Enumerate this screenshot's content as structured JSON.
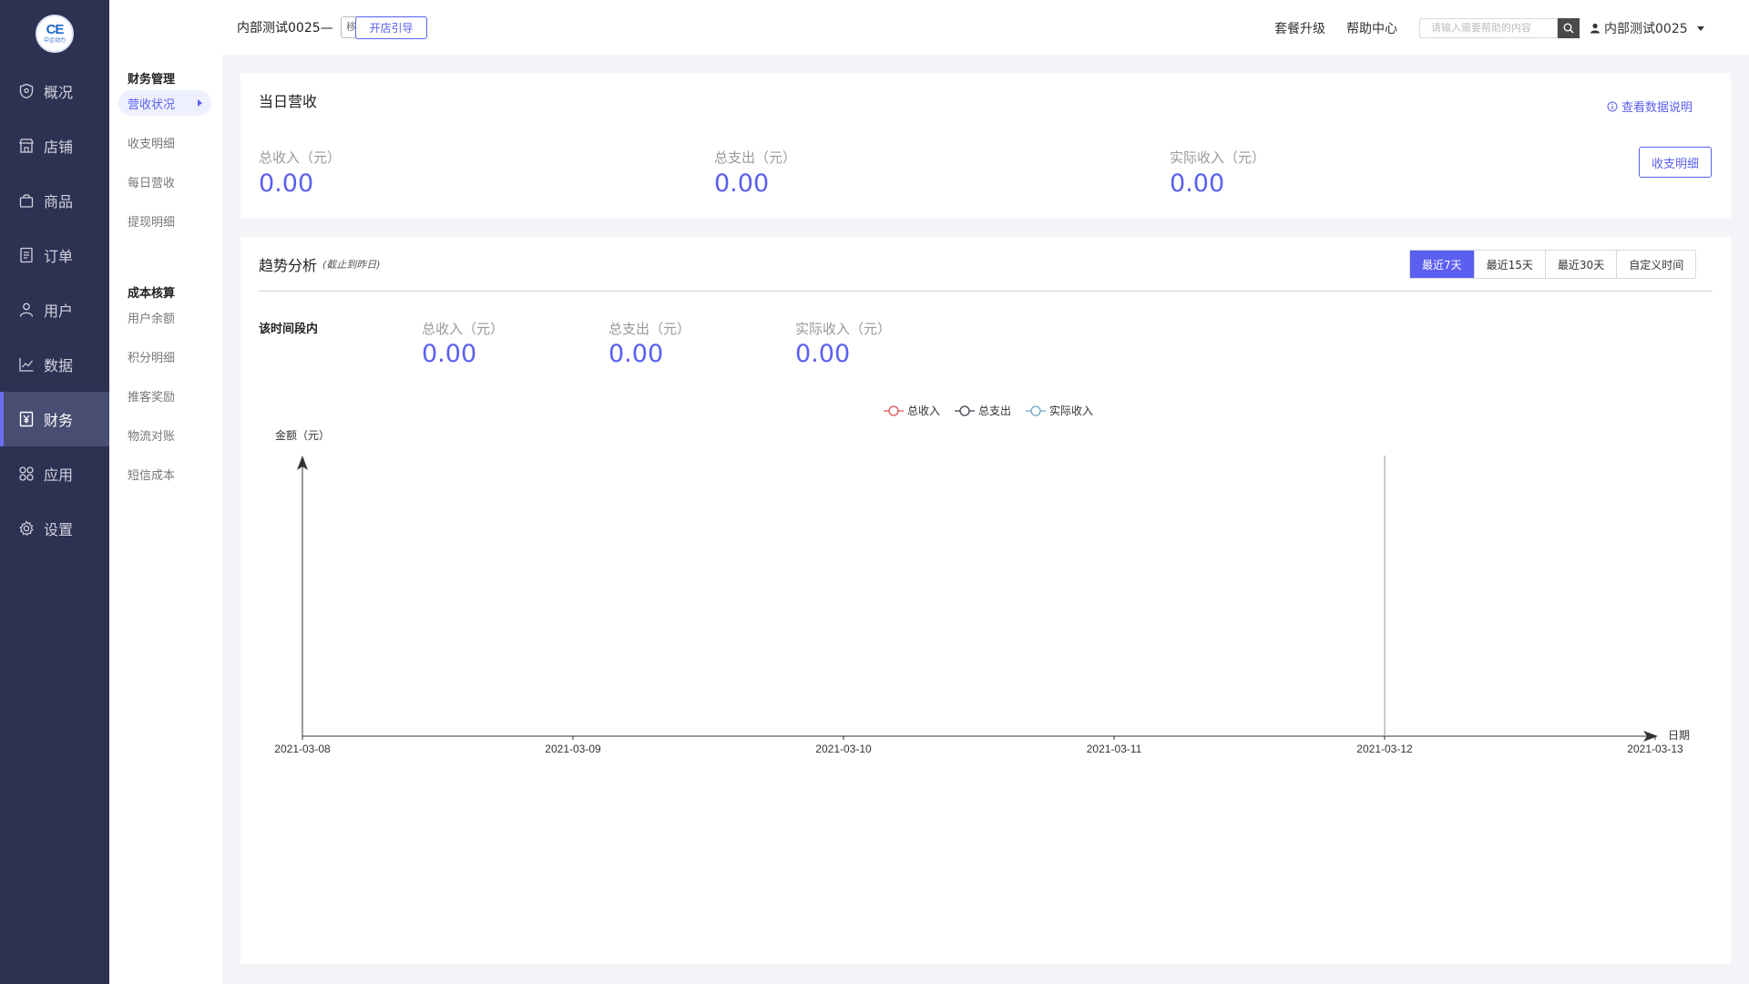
{
  "logo": {
    "mark": "CE",
    "text": "中企动力"
  },
  "nav": {
    "items": [
      {
        "label": "概况",
        "icon": "shield-icon"
      },
      {
        "label": "店铺",
        "icon": "store-icon"
      },
      {
        "label": "商品",
        "icon": "bag-icon"
      },
      {
        "label": "订单",
        "icon": "document-icon"
      },
      {
        "label": "用户",
        "icon": "user-icon"
      },
      {
        "label": "数据",
        "icon": "line-chart-icon"
      },
      {
        "label": "财务",
        "icon": "yuan-icon"
      },
      {
        "label": "应用",
        "icon": "apps-icon"
      },
      {
        "label": "设置",
        "icon": "gear-icon"
      }
    ],
    "active": "财务"
  },
  "subnav": {
    "groups": [
      {
        "title": "财务管理",
        "items": [
          "营收状况",
          "收支明细",
          "每日营收",
          "提现明细"
        ]
      },
      {
        "title": "成本核算",
        "items": [
          "用户余额",
          "积分明细",
          "推客奖励",
          "物流对账",
          "短信成本"
        ]
      }
    ],
    "active": "营收状况"
  },
  "header": {
    "shop_name": "内部测试0025—",
    "edition": "移动商城-专业版",
    "guide_button": "开店引导",
    "upgrade_link": "套餐升级",
    "help_link": "帮助中心",
    "search_placeholder": "请输入需要帮助的内容",
    "user_name": "内部测试0025"
  },
  "today": {
    "title": "当日营收",
    "data_note_link": "查看数据说明",
    "details_button": "收支明细",
    "stats": [
      {
        "label": "总收入（元）",
        "value": "0.00"
      },
      {
        "label": "总支出（元）",
        "value": "0.00"
      },
      {
        "label": "实际收入（元）",
        "value": "0.00"
      }
    ]
  },
  "trend": {
    "title": "趋势分析",
    "subtitle": "(截止到昨日)",
    "ranges": [
      "最近7天",
      "最近15天",
      "最近30天",
      "自定义时间"
    ],
    "active_range": "最近7天",
    "period_label": "该时间段内",
    "stats": [
      {
        "label": "总收入（元）",
        "value": "0.00"
      },
      {
        "label": "总支出（元）",
        "value": "0.00"
      },
      {
        "label": "实际收入（元）",
        "value": "0.00"
      }
    ]
  },
  "chart_data": {
    "type": "line",
    "x": [
      "2021-03-08",
      "2021-03-09",
      "2021-03-10",
      "2021-03-11",
      "2021-03-12",
      "2021-03-13"
    ],
    "series": [
      {
        "name": "总收入",
        "values": [],
        "color": "#e0524c"
      },
      {
        "name": "总支出",
        "values": [],
        "color": "#3a3f4a"
      },
      {
        "name": "实际收入",
        "values": [],
        "color": "#6fa6c4"
      }
    ],
    "ylabel": "金额（元）",
    "xlabel": "日期",
    "highlight_x": "2021-03-12",
    "legend": "top-center",
    "grid": false
  },
  "colors": {
    "accent": "#5b5ff0",
    "sidebar": "#2d3152",
    "sidebar_active": "#484d72"
  }
}
